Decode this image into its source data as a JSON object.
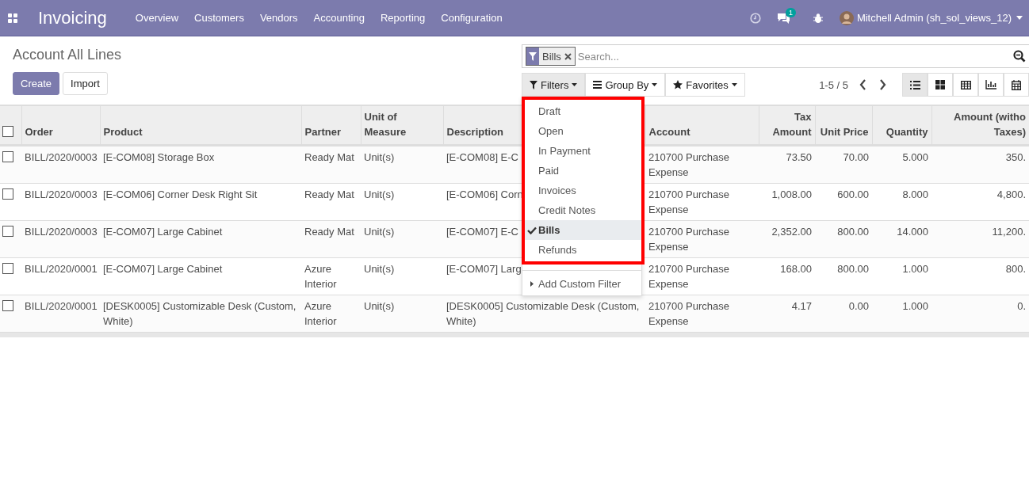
{
  "navbar": {
    "app_title": "Invoicing",
    "menu": [
      "Overview",
      "Customers",
      "Vendors",
      "Accounting",
      "Reporting",
      "Configuration"
    ],
    "message_count": "1",
    "user": "Mitchell Admin (sh_sol_views_12)"
  },
  "breadcrumb": "Account All Lines",
  "buttons": [
    "Create",
    "Import"
  ],
  "search": {
    "facet": "Bills",
    "placeholder": "Search..."
  },
  "search_buttons": [
    {
      "label": "Filters",
      "kind": "filter",
      "selected": true
    },
    {
      "label": "Group By",
      "kind": "group",
      "selected": false
    },
    {
      "label": "Favorites",
      "kind": "star",
      "selected": false
    }
  ],
  "pager": "1-5 / 5",
  "views": [
    {
      "kind": "list",
      "selected": true
    },
    {
      "kind": "kanban",
      "selected": false
    },
    {
      "kind": "pivot",
      "selected": false
    },
    {
      "kind": "graph",
      "selected": false
    },
    {
      "kind": "calendar",
      "selected": false
    }
  ],
  "filters_menu": {
    "items": [
      {
        "label": "Draft",
        "checked": false
      },
      {
        "label": "Open",
        "checked": false
      },
      {
        "label": "In Payment",
        "checked": false
      },
      {
        "label": "Paid",
        "checked": false
      },
      {
        "label": "Invoices",
        "checked": false
      },
      {
        "label": "Credit Notes",
        "checked": false
      },
      {
        "label": "Bills",
        "checked": true
      },
      {
        "label": "Refunds",
        "checked": false
      }
    ],
    "custom": "Add Custom Filter"
  },
  "table": {
    "all_checked": false,
    "columns": [
      {
        "label": "Order",
        "kind": "text"
      },
      {
        "label": "Product",
        "kind": "text"
      },
      {
        "label": "Partner",
        "kind": "text"
      },
      {
        "label": "Unit of Measure",
        "kind": "text"
      },
      {
        "label": "Description",
        "kind": "text"
      },
      {
        "label": "Account",
        "kind": "text"
      },
      {
        "label": "Tax Amount",
        "kind": "number"
      },
      {
        "label": "Unit Price",
        "kind": "number"
      },
      {
        "label": "Quantity",
        "kind": "number"
      },
      {
        "label": "Amount (witho Taxes)",
        "kind": "number"
      }
    ],
    "rows": [
      {
        "checked": false,
        "cells": [
          "BILL/2020/0003",
          "[E-COM08] Storage Box",
          "Ready Mat",
          "Unit(s)",
          "[E-COM08] E-C",
          "210700 Purchase Expense",
          "73.50",
          "70.00",
          "5.000",
          "350."
        ]
      },
      {
        "checked": false,
        "cells": [
          "BILL/2020/0003",
          "[E-COM06] Corner Desk Right Sit",
          "Ready Mat",
          "Unit(s)",
          "[E-COM06] Corn",
          "210700 Purchase Expense",
          "1,008.00",
          "600.00",
          "8.000",
          "4,800."
        ]
      },
      {
        "checked": false,
        "cells": [
          "BILL/2020/0003",
          "[E-COM07] Large Cabinet",
          "Ready Mat",
          "Unit(s)",
          "[E-COM07] E-C",
          "210700 Purchase Expense",
          "2,352.00",
          "800.00",
          "14.000",
          "11,200."
        ]
      },
      {
        "checked": false,
        "cells": [
          "BILL/2020/0001",
          "[E-COM07] Large Cabinet",
          "Azure Interior",
          "Unit(s)",
          "[E-COM07] Larg",
          "210700 Purchase Expense",
          "168.00",
          "800.00",
          "1.000",
          "800."
        ]
      },
      {
        "checked": false,
        "cells": [
          "BILL/2020/0001",
          "[DESK0005] Customizable Desk (Custom, White)",
          "Azure Interior",
          "Unit(s)",
          "[DESK0005] Customizable Desk (Custom, White)",
          "210700 Purchase Expense",
          "4.17",
          "0.00",
          "1.000",
          "0."
        ]
      }
    ]
  }
}
